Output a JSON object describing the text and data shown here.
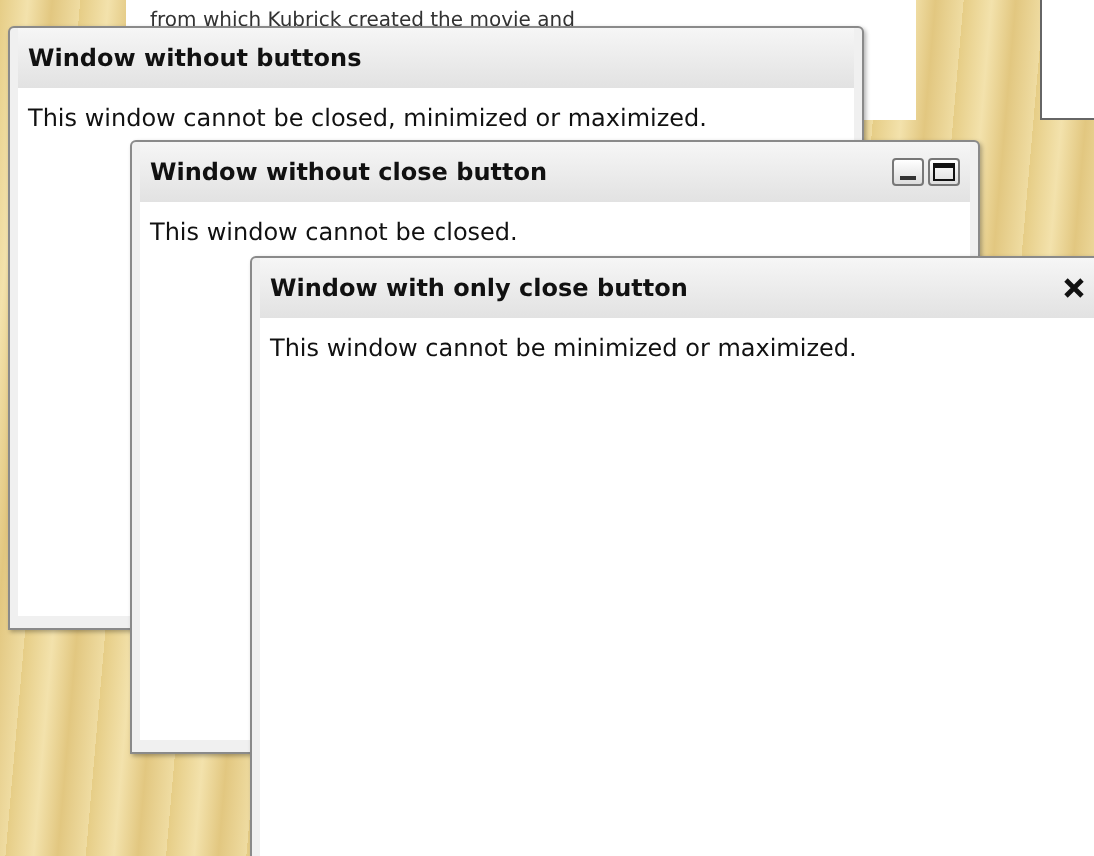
{
  "background_page": {
    "text": "from which Kubrick created the movie and"
  },
  "windows": [
    {
      "title": "Window without buttons",
      "body": "This window cannot be closed, minimized or maximized."
    },
    {
      "title": "Window without close button",
      "body": "This window cannot be closed.",
      "buttons": [
        {
          "kind": "minimize"
        },
        {
          "kind": "maximize"
        }
      ]
    },
    {
      "title": "Window with only close button",
      "body": "This window cannot be minimized or maximized.",
      "buttons": [
        {
          "kind": "close"
        }
      ]
    }
  ]
}
